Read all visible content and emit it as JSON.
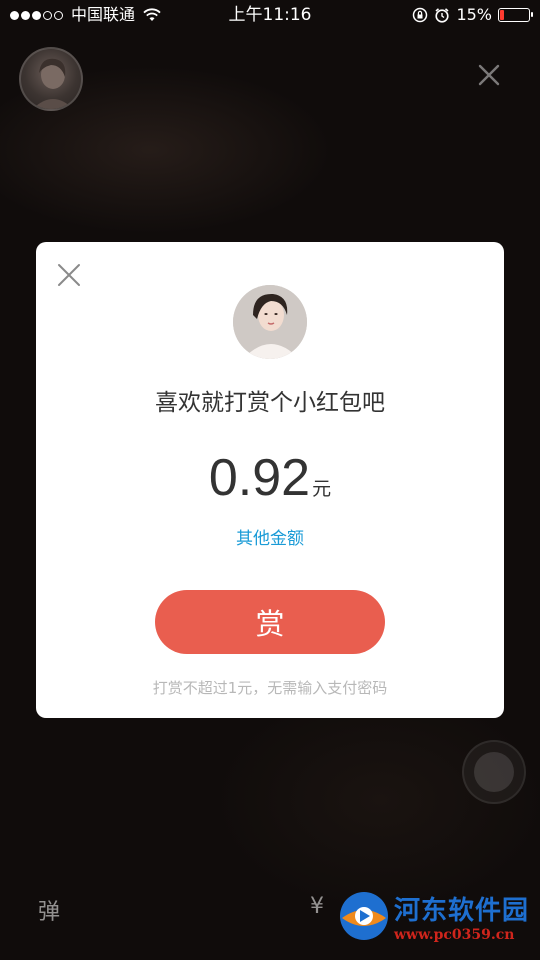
{
  "status_bar": {
    "carrier": "中国联通",
    "time": "上午11:16",
    "battery_percent": "15%",
    "battery_level": 0.15,
    "icons": [
      "signal-dots",
      "wifi-icon",
      "rotation-lock-icon",
      "alarm-icon",
      "battery-icon"
    ]
  },
  "background": {
    "danmu_label": "弹",
    "yuan_label": "¥",
    "watermark_title": "河东软件园",
    "watermark_url": "www.pc0359.cn"
  },
  "modal": {
    "title": "喜欢就打赏个小红包吧",
    "amount": "0.92",
    "unit": "元",
    "other_amount": "其他金额",
    "reward_button": "赏",
    "hint": "打赏不超过1元，无需输入支付密码"
  },
  "colors": {
    "accent": "#e95e4f",
    "link": "#1a9bd7",
    "battery_low": "#ff3b30"
  }
}
